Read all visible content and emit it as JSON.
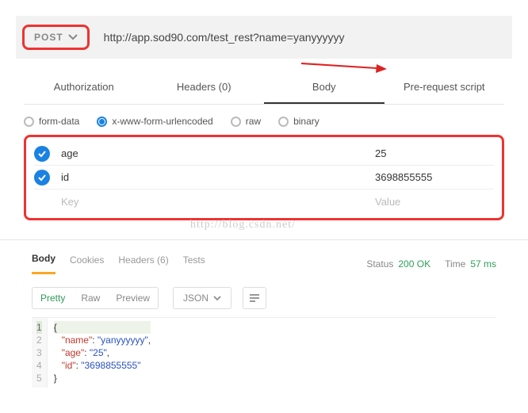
{
  "request": {
    "method": "POST",
    "url": "http://app.sod90.com/test_rest?name=yanyyyyyy"
  },
  "tabs": {
    "authorization": "Authorization",
    "headers": "Headers (0)",
    "body": "Body",
    "prerequest": "Pre-request script"
  },
  "body_types": {
    "form_data": "form-data",
    "urlencoded": "x-www-form-urlencoded",
    "raw": "raw",
    "binary": "binary"
  },
  "params": {
    "rows": [
      {
        "key": "age",
        "value": "25"
      },
      {
        "key": "id",
        "value": "3698855555"
      }
    ],
    "key_placeholder": "Key",
    "value_placeholder": "Value"
  },
  "watermark": "http://blog.csdn.net/",
  "response": {
    "tabs": {
      "body": "Body",
      "cookies": "Cookies",
      "headers": "Headers (6)",
      "tests": "Tests"
    },
    "status_label": "Status",
    "status_value": "200 OK",
    "time_label": "Time",
    "time_value": "57 ms",
    "view": {
      "pretty": "Pretty",
      "raw": "Raw",
      "preview": "Preview"
    },
    "format": "JSON",
    "code_lines": {
      "l1": "{",
      "l2_k": "\"name\"",
      "l2_v": "\"yanyyyyyy\"",
      "l3_k": "\"age\"",
      "l3_v": "\"25\"",
      "l4_k": "\"id\"",
      "l4_v": "\"3698855555\"",
      "l5": "}"
    }
  }
}
